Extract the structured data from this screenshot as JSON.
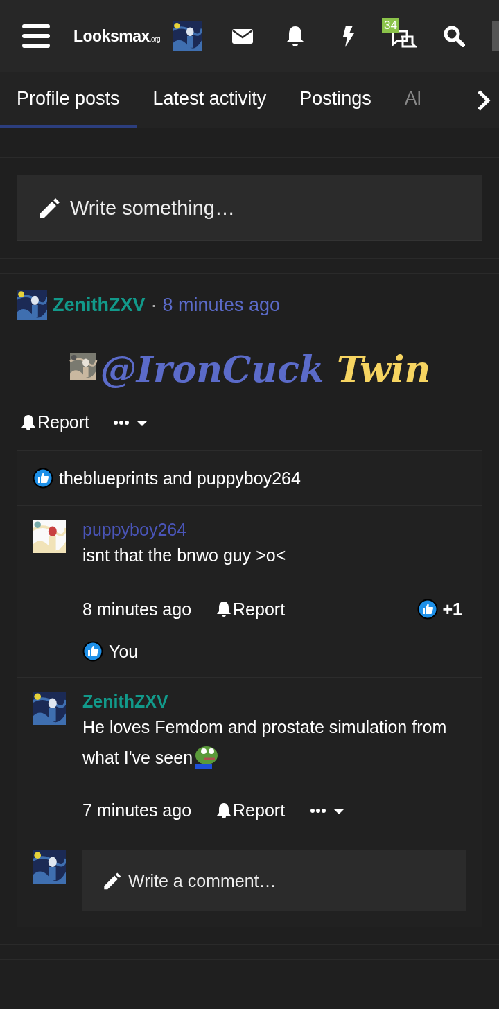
{
  "header": {
    "logo": {
      "name": "Looksmax",
      "suffix": ".org"
    },
    "conversations_badge": "34"
  },
  "tabs": [
    {
      "label": "Profile posts",
      "selected": true
    },
    {
      "label": "Latest activity",
      "selected": false
    },
    {
      "label": "Postings",
      "selected": false
    },
    {
      "label": "Al",
      "selected": false,
      "cut": true
    }
  ],
  "composer": {
    "placeholder": "Write something…"
  },
  "post": {
    "author": {
      "name": "ZenithZXV",
      "color": "#12998a"
    },
    "separator": "·",
    "time": "8 minutes ago",
    "body": [
      {
        "text": "@IronCuck",
        "color": "#5b6bc9"
      },
      {
        "text": "Twin",
        "color": "#f6d461"
      }
    ],
    "actions": {
      "report": "Report"
    },
    "reactions": "theblueprints and puppyboy264",
    "comments": [
      {
        "author": "puppyboy264",
        "color": "#4a55b8",
        "text": "isnt that the bnwo guy >o<",
        "emoji": false,
        "time": "8 minutes ago",
        "report": "Report",
        "reaction_count": "+1",
        "reacted_by": "You",
        "more_menu": false
      },
      {
        "author": "ZenithZXV",
        "color": "#12998a",
        "text": "He loves Femdom and prostate simulation from what I've seen",
        "emoji": true,
        "time": "7 minutes ago",
        "report": "Report",
        "more_menu": true
      }
    ],
    "comment_box": {
      "placeholder": "Write a comment…"
    }
  }
}
